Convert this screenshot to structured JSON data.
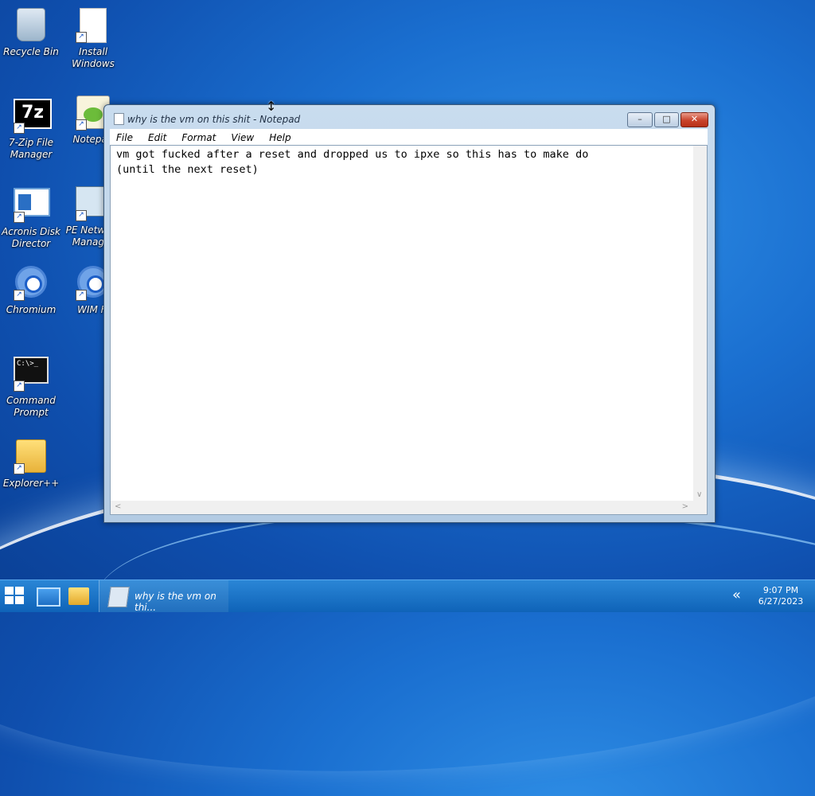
{
  "desktop": {
    "icons": [
      {
        "label": "Recycle Bin"
      },
      {
        "label": "Install Windows"
      },
      {
        "label": "7-Zip File Manager"
      },
      {
        "label": "Notepad"
      },
      {
        "label": "Acronis Disk Director"
      },
      {
        "label": "PE Network Manager"
      },
      {
        "label": "Chromium"
      },
      {
        "label": "WIM Fi"
      },
      {
        "label": "Command Prompt"
      },
      {
        "label": "Explorer++"
      }
    ],
    "sevenzip_glyph": "7z",
    "cmd_glyph": "C:\\>_"
  },
  "window": {
    "title": "why is the vm on this shit - Notepad",
    "buttons": {
      "minimize": "–",
      "maximize": "□",
      "close": "✕"
    },
    "menu": [
      "File",
      "Edit",
      "Format",
      "View",
      "Help"
    ],
    "content": "vm got fucked after a reset and dropped us to ipxe so this has to make do\n(until the next reset)"
  },
  "taskbar": {
    "task_label": "why is the vm on thi...",
    "tray_chevron": "«",
    "time": "9:07 PM",
    "date": "6/27/2023"
  },
  "colors": {
    "desktop_bg": "#1a6fd0",
    "taskbar": "#1a74c8",
    "close_button": "#c8432b"
  }
}
